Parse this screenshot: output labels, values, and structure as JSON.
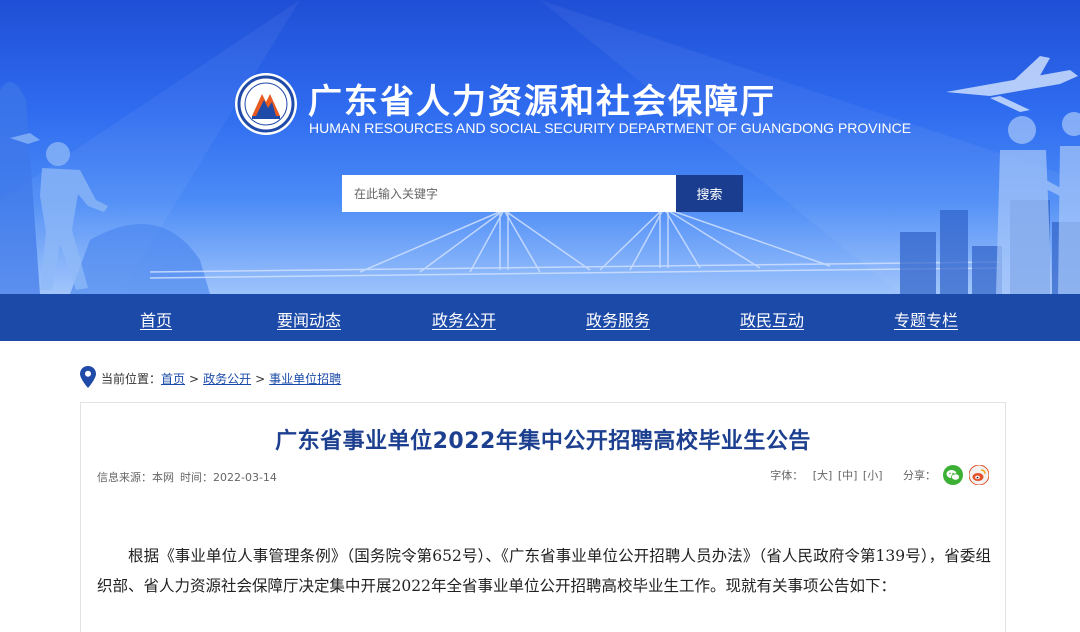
{
  "header": {
    "title": "广东省人力资源和社会保障厅",
    "subtitle": "HUMAN RESOURCES AND SOCIAL SECURITY DEPARTMENT OF GUANGDONG PROVINCE",
    "logo_icon": "department-emblem-icon"
  },
  "search": {
    "placeholder": "在此输入关键字",
    "button_label": "搜索"
  },
  "nav": {
    "items": [
      {
        "label": "首页"
      },
      {
        "label": "要闻动态"
      },
      {
        "label": "政务公开"
      },
      {
        "label": "政务服务"
      },
      {
        "label": "政民互动"
      },
      {
        "label": "专题专栏"
      }
    ]
  },
  "breadcrumb": {
    "prefix": "当前位置：",
    "items": [
      {
        "label": "首页"
      },
      {
        "label": "政务公开"
      },
      {
        "label": "事业单位招聘"
      }
    ],
    "separator": ">"
  },
  "article": {
    "title": "广东省事业单位2022年集中公开招聘高校毕业生公告",
    "source_label": "信息来源：本网",
    "time_label": "时间：2022-03-14",
    "font_label": "字体：",
    "size_large": "[大]",
    "size_medium": "[中]",
    "size_small": "[小]",
    "share_label": "分享：",
    "body": "根据《事业单位人事管理条例》（国务院令第652号）、《广东省事业单位公开招聘人员办法》（省人民政府令第139号），省委组织部、省人力资源社会保障厅决定集中开展2022年全省事业单位公开招聘高校毕业生工作。现就有关事项公告如下："
  },
  "colors": {
    "banner_top": "#1f4fd6",
    "nav_bg": "#1c4aa8",
    "search_button": "#1a3d8f",
    "title_color": "#1d3f8f",
    "wechat_green": "#3cb034",
    "weibo_red": "#e6512b"
  }
}
